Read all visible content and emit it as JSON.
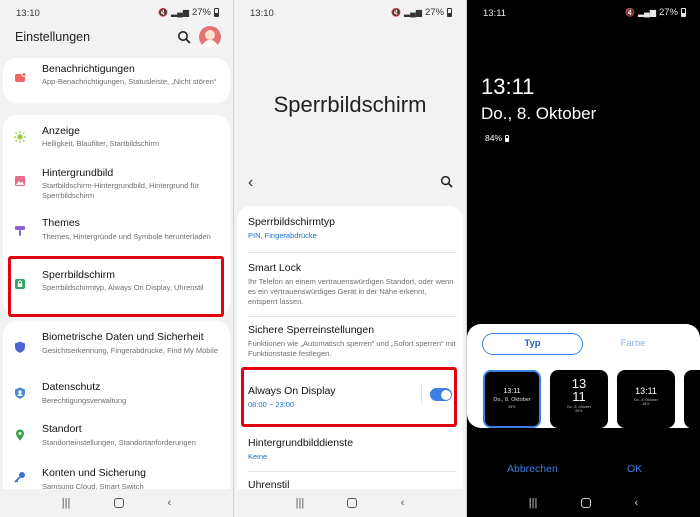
{
  "panel1": {
    "status": {
      "time": "13:10",
      "battery": "27%"
    },
    "title": "Einstellungen",
    "items": [
      {
        "title": "Benachrichtigungen",
        "desc": "App-Benachrichtigungen, Statusleiste, „Nicht stören“",
        "icon": "notification-icon",
        "color": "#f06363"
      },
      {
        "title": "Anzeige",
        "desc": "Helligkeit, Blaufilter, Startbildschirm",
        "icon": "sun-icon",
        "color": "#9acb3b"
      },
      {
        "title": "Hintergrundbild",
        "desc": "Startbildschirm-Hintergrundbild, Hintergrund für Sperrbildschirm",
        "icon": "picture-icon",
        "color": "#e86a8a"
      },
      {
        "title": "Themes",
        "desc": "Themes, Hintergründe und Symbole herunterladen",
        "icon": "brush-icon",
        "color": "#8a63d2"
      },
      {
        "title": "Sperrbildschirm",
        "desc": "Sperrbildschirmtyp, Always On Display, Uhrenstil",
        "icon": "lock-icon",
        "color": "#2fa866"
      },
      {
        "title": "Biometrische Daten und Sicherheit",
        "desc": "Gesichtserkennung, Fingerabdrücke, Find My Mobile",
        "icon": "shield-icon",
        "color": "#4f63d8"
      },
      {
        "title": "Datenschutz",
        "desc": "Berechtigungsverwaltung",
        "icon": "privacy-icon",
        "color": "#4a89d8"
      },
      {
        "title": "Standort",
        "desc": "Standorteinstellungen, Standortanforderungen",
        "icon": "location-pin-icon",
        "color": "#3aa44a"
      },
      {
        "title": "Konten und Sicherung",
        "desc": "Samsung Cloud, Smart Switch",
        "icon": "key-icon",
        "color": "#3d6fd4"
      }
    ]
  },
  "panel2": {
    "status": {
      "time": "13:10",
      "battery": "27%"
    },
    "title": "Sperrbildschirm",
    "items": [
      {
        "title": "Sperrbildschirmtyp",
        "sub": "PIN, Fingerabdrücke"
      },
      {
        "title": "Smart Lock",
        "desc": "Ihr Telefon an einem vertrauenswürdigen Standort, oder wenn es ein vertrauenswürdiges Gerät in der Nähe erkennt, entsperrt lassen."
      },
      {
        "title": "Sichere Sperreinstellungen",
        "desc": "Funktionen wie „Automatisch sperren“ und „Sofort sperren“ mit Funktionstaste festlegen."
      },
      {
        "title": "Always On Display",
        "sub": "08:00 ~ 23:00",
        "enabled": true
      },
      {
        "title": "Hintergrundbilddienste",
        "sub": "Keine"
      },
      {
        "title": "Uhrenstil"
      }
    ]
  },
  "panel3": {
    "status": {
      "time": "13:11",
      "battery": "27%"
    },
    "clock": "13:11",
    "date": "Do., 8. Oktober",
    "battery_pct": "84%",
    "tabs": {
      "active": "Typ",
      "inactive": "Farbe"
    },
    "thumbs": [
      {
        "line1": "13:11",
        "line2": "Do., 8. Oktober",
        "line3": "84%"
      },
      {
        "line1": "13",
        "line2": "11",
        "line3": "Do., 8. Oktober",
        "line4": "84%"
      },
      {
        "line1": "13:11",
        "line2": "Do., 8. Oktober",
        "line3": "84%"
      }
    ],
    "cancel": "Abbrechen",
    "ok": "OK"
  },
  "colors": {
    "accent": "#3d7fe0",
    "highlight": "#e3000f"
  }
}
